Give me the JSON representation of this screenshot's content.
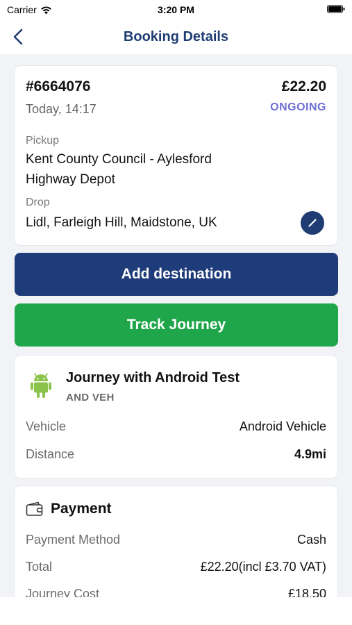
{
  "status_bar": {
    "carrier": "Carrier",
    "time": "3:20 PM"
  },
  "nav": {
    "title": "Booking Details"
  },
  "booking": {
    "id": "#6664076",
    "price": "£22.20",
    "date": "Today, 14:17",
    "status": "ONGOING",
    "pickup_label": "Pickup",
    "pickup_value": "Kent County Council - Aylesford Highway Depot",
    "drop_label": "Drop",
    "drop_value": "Lidl, Farleigh Hill, Maidstone, UK"
  },
  "buttons": {
    "add_destination": "Add destination",
    "track_journey": "Track Journey"
  },
  "journey": {
    "title": "Journey with Android Test",
    "subtitle": "AND VEH",
    "vehicle_label": "Vehicle",
    "vehicle_value": "Android Vehicle",
    "distance_label": "Distance",
    "distance_value": "4.9mi"
  },
  "payment": {
    "title": "Payment",
    "method_label": "Payment Method",
    "method_value": "Cash",
    "total_label": "Total",
    "total_value": "£22.20(incl £3.70 VAT)",
    "cost_label": "Journey Cost",
    "cost_value": "£18.50"
  },
  "colors": {
    "brand_blue": "#1f3c73",
    "track_green": "#1fa64a",
    "status_purple": "#6c6fd6",
    "android_green": "#8bc34a"
  },
  "icons": {
    "back": "chevron-left-icon",
    "edit": "pencil-icon",
    "vehicle": "android-icon",
    "payment": "wallet-icon",
    "wifi": "wifi-icon",
    "battery": "battery-icon"
  }
}
